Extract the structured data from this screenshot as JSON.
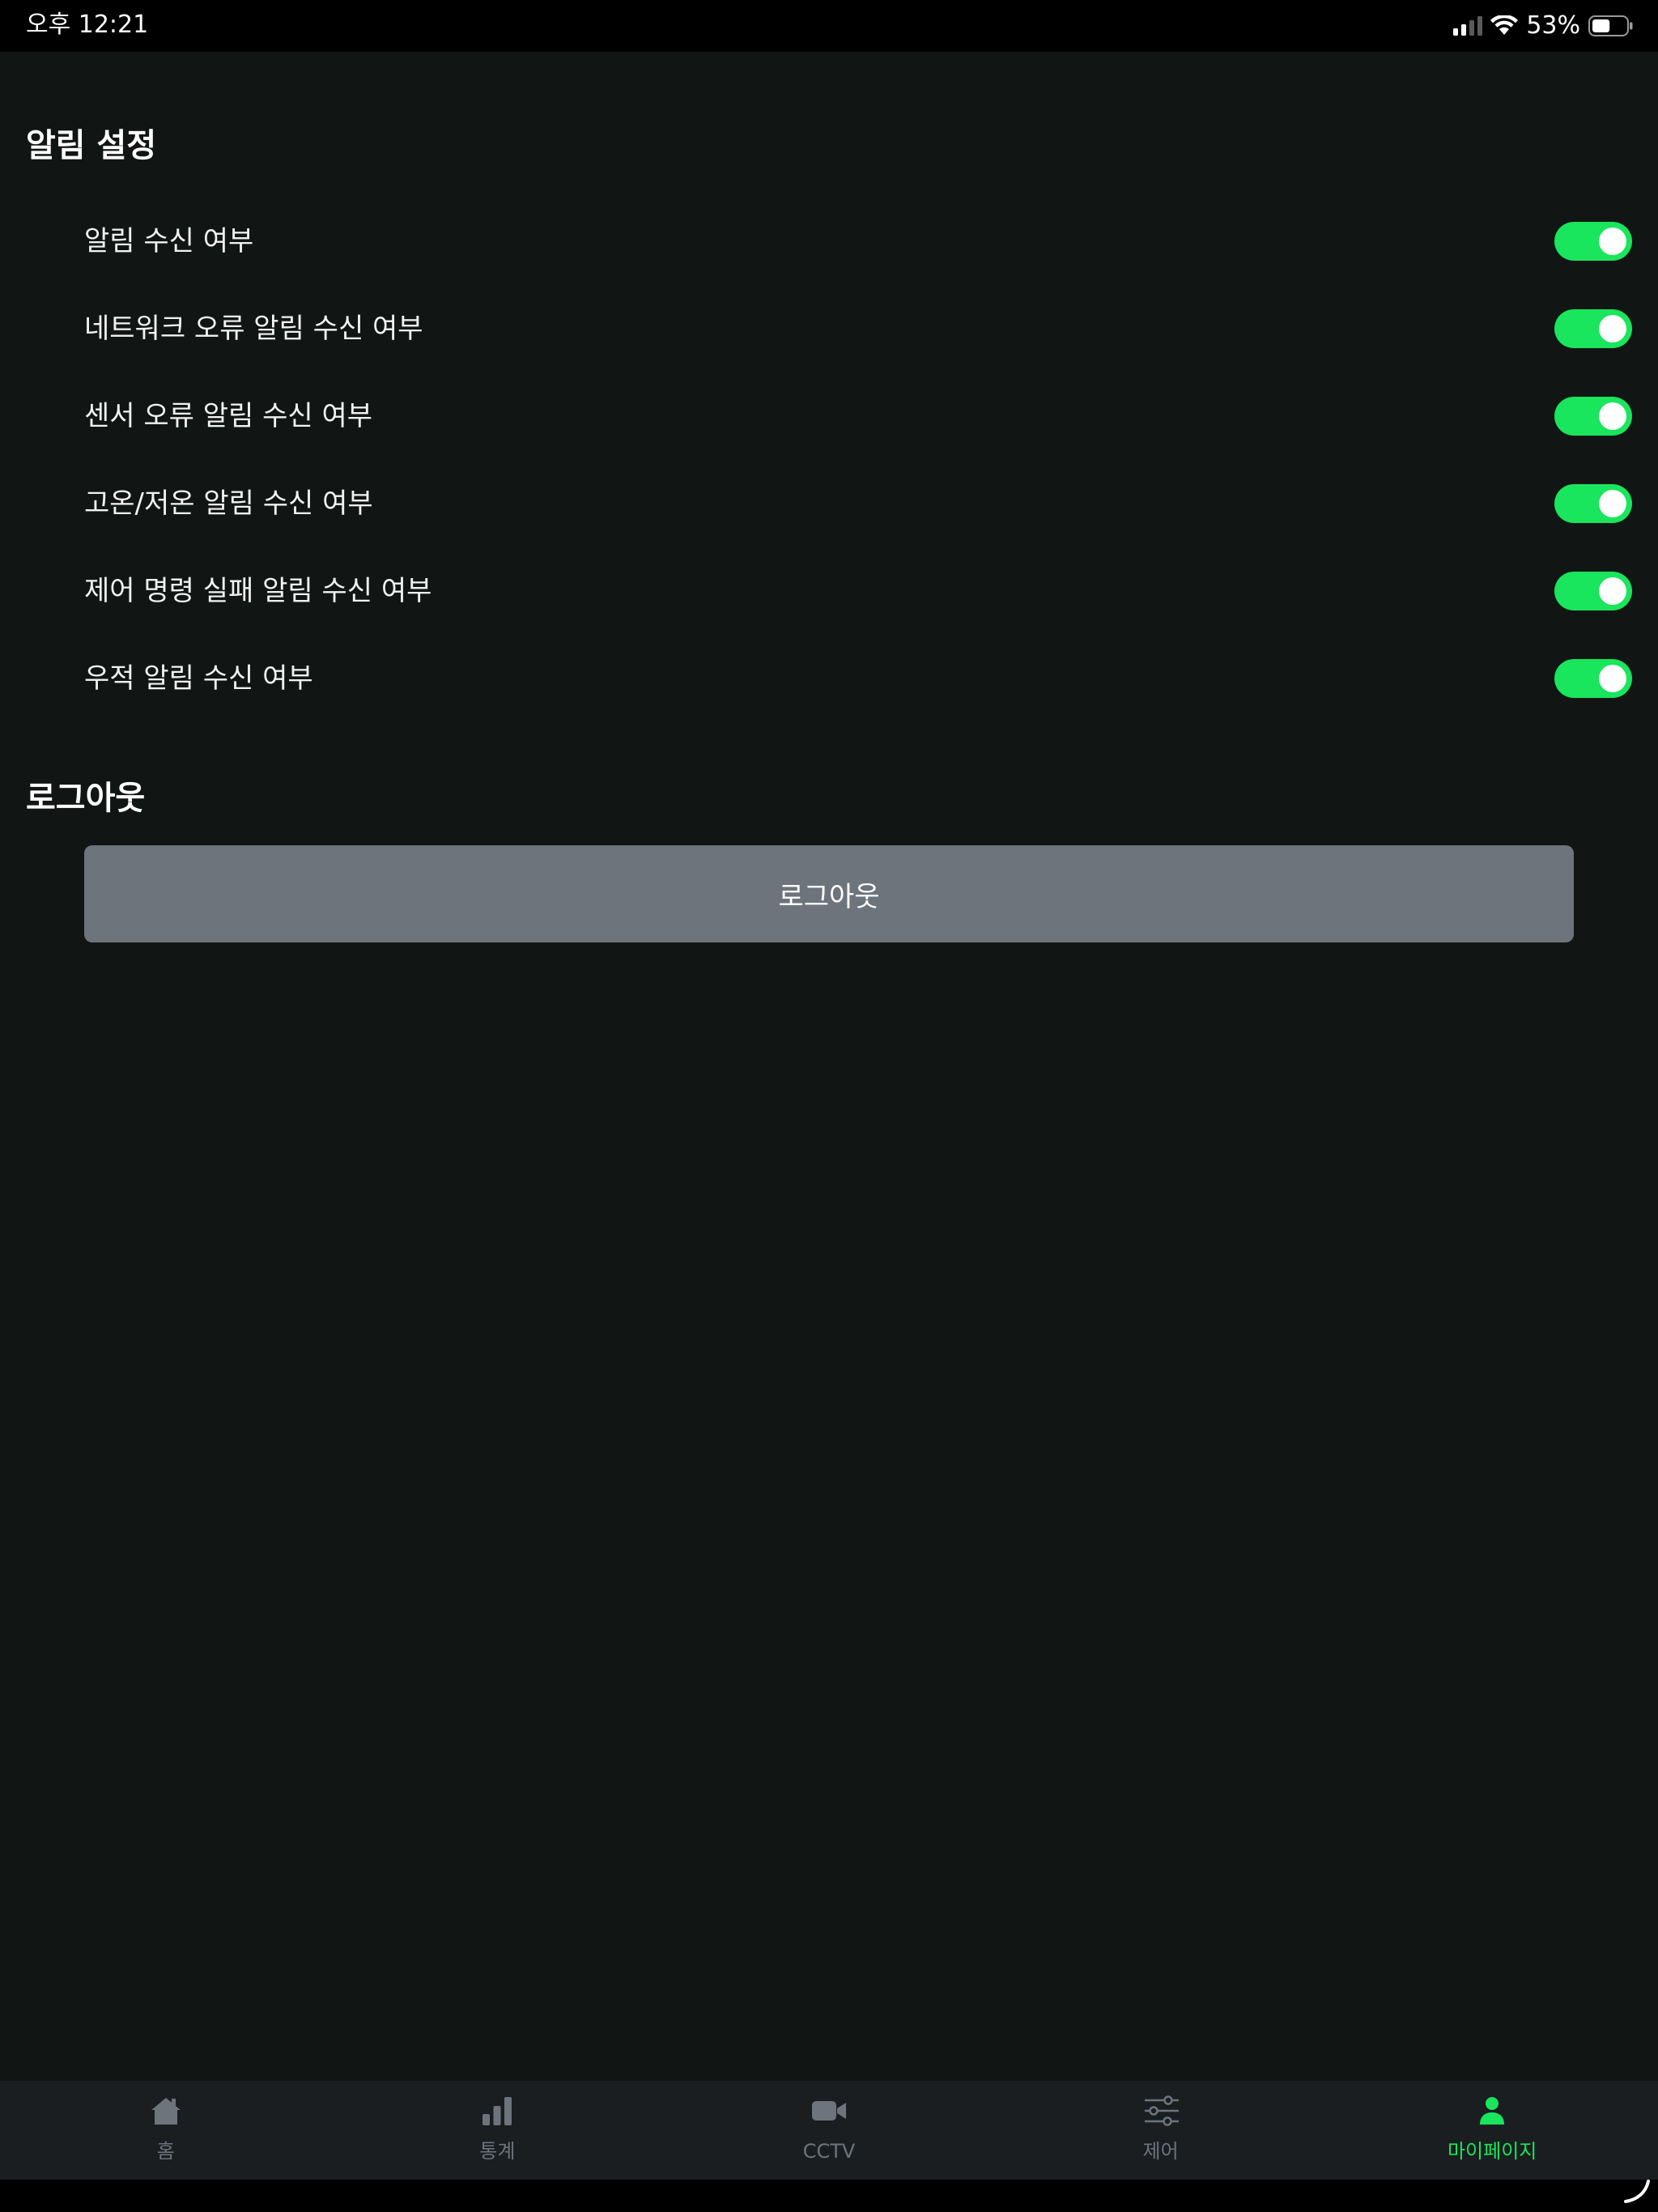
{
  "status_bar": {
    "time": "오후 12:21",
    "battery_percent": "53%",
    "battery_level": 0.53,
    "icons": [
      "signal-icon",
      "wifi-icon",
      "battery-icon"
    ]
  },
  "notification_settings": {
    "title": "알림 설정",
    "items": [
      {
        "label": "알림 수신 여부",
        "enabled": true
      },
      {
        "label": "네트워크 오류 알림 수신 여부",
        "enabled": true
      },
      {
        "label": "센서 오류 알림 수신 여부",
        "enabled": true
      },
      {
        "label": "고온/저온 알림 수신 여부",
        "enabled": true
      },
      {
        "label": "제어 명령 실패 알림 수신 여부",
        "enabled": true
      },
      {
        "label": "우적 알림 수신 여부",
        "enabled": true
      }
    ]
  },
  "logout": {
    "title": "로그아웃",
    "button_label": "로그아웃"
  },
  "tab_bar": {
    "tabs": [
      {
        "label": "홈",
        "icon": "home-icon",
        "active": false
      },
      {
        "label": "통계",
        "icon": "bar-chart-icon",
        "active": false
      },
      {
        "label": "CCTV",
        "icon": "video-camera-icon",
        "active": false
      },
      {
        "label": "제어",
        "icon": "sliders-icon",
        "active": false
      },
      {
        "label": "마이페이지",
        "icon": "user-icon",
        "active": true
      }
    ]
  },
  "colors": {
    "background": "#111614",
    "toggle_on": "#19e55d",
    "button_gray": "#6d747c",
    "tab_bar_bg": "#1b1e21",
    "tab_inactive": "#6d747c",
    "tab_active": "#19e55d"
  }
}
